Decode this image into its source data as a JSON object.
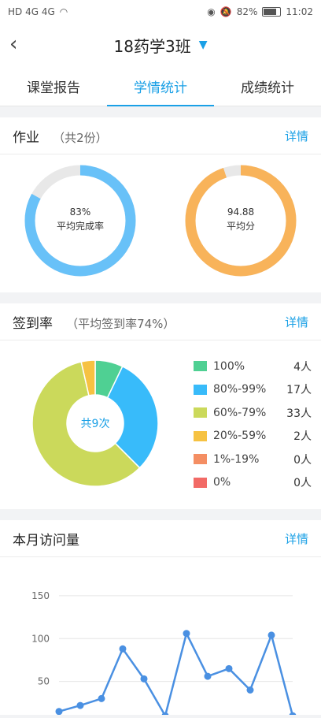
{
  "statusbar": {
    "left_icons": "HD 4G 4G",
    "wifi_icon": "wifi-icon",
    "battery_percent": "82%",
    "time": "11:02"
  },
  "header": {
    "back_icon": "chevron-left-icon",
    "class_name": "18药学3班",
    "dropdown_icon": "chevron-down-icon"
  },
  "tabs": [
    {
      "label": "课堂报告"
    },
    {
      "label": "学情统计"
    },
    {
      "label": "成绩统计"
    }
  ],
  "homework": {
    "title": "作业",
    "subtitle": "（共2份）",
    "detail_label": "详情",
    "completion": {
      "value": "83%",
      "label": "平均完成率",
      "fraction": 0.83,
      "color": "#68c1f8"
    },
    "average": {
      "value": "94.88",
      "label": "平均分",
      "fraction": 0.9488,
      "color": "#f8b35a"
    }
  },
  "checkin": {
    "title": "签到率",
    "subtitle": "（平均签到率74%）",
    "detail_label": "详情",
    "center_label": "共9次",
    "legend": [
      {
        "label": "100%",
        "count": "4人",
        "value": 4,
        "color": "#4fd093"
      },
      {
        "label": "80%-99%",
        "count": "17人",
        "value": 17,
        "color": "#38bbfa"
      },
      {
        "label": "60%-79%",
        "count": "33人",
        "value": 33,
        "color": "#cbd95b"
      },
      {
        "label": "20%-59%",
        "count": "2人",
        "value": 2,
        "color": "#f6c242"
      },
      {
        "label": "1%-19%",
        "count": "0人",
        "value": 0,
        "color": "#f48e63"
      },
      {
        "label": "0%",
        "count": "0人",
        "value": 0,
        "color": "#f26a66"
      }
    ]
  },
  "visits": {
    "title": "本月访问量",
    "detail_label": "详情"
  },
  "chart_data": {
    "type": "line",
    "yticks": [
      150,
      100,
      50
    ],
    "ylim": [
      0,
      160
    ],
    "x": [
      1,
      2,
      3,
      4,
      5,
      6,
      7,
      8,
      9,
      10,
      11,
      12
    ],
    "values": [
      15,
      22,
      30,
      88,
      53,
      10,
      106,
      56,
      65,
      40,
      104,
      10
    ],
    "color": "#4a90e2"
  }
}
